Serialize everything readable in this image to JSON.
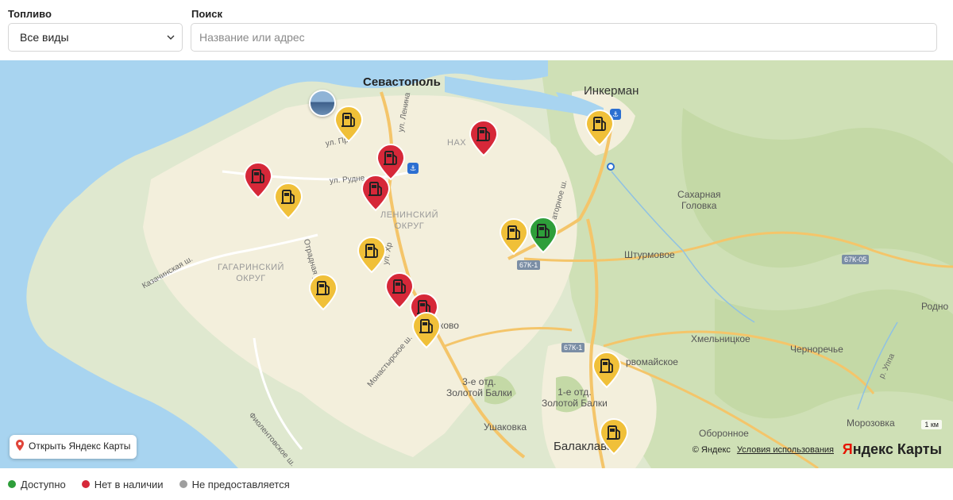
{
  "filters": {
    "fuel_label": "Топливо",
    "fuel_selected": "Все виды",
    "search_label": "Поиск",
    "search_placeholder": "Название или адрес"
  },
  "map": {
    "places": {
      "sevastopol": "Севастополь",
      "inkerman": "Инкерман",
      "sakharnaya_1": "Сахарная",
      "sakharnaya_2": "Головка",
      "shturmovoe": "Штурмовое",
      "khmelnitskoe": "Хмельницкое",
      "chernorechye": "Черноречье",
      "rodnoe": "Родно",
      "pervomayskoe": "рвомайское",
      "zolotaya_3_1": "3-е отд.",
      "zolotaya_3_2": "Золотой Балки",
      "zolotaya_1_1": "1-е отд.",
      "zolotaya_1_2": "Золотой Балки",
      "ushakovka": "Ушаковка",
      "balaklava": "Балаклава",
      "oboronnoe": "Оборонное",
      "morozovka": "Морозовка",
      "kamyshovo": "ково",
      "nakhimovsky": "НАХ",
      "leninsky_1": "ЛЕНИНСКИЙ",
      "leninsky_2": "ОКРУГ",
      "gagarinsky_1": "ГАГАРИНСКИЙ",
      "gagarinsky_2": "ОКРУГ"
    },
    "streets": {
      "lenina": "ул. Ленина",
      "pr": "ул. Пр",
      "rudneva": "ул. Рудне",
      "otradnaya": "Отрадная ул.",
      "kazachinskaya": "Казачинская ш.",
      "monastyrskoe": "Монастырское ш.",
      "fiolentovskoe": "Фиолентовское ш.",
      "khr": "ул. Хр",
      "sevastopol_sh": "аторное ш.",
      "r_uppa": "р. Уппа"
    },
    "road_badges": {
      "r1": "67К-1",
      "r2": "67К-1",
      "r3": "67К-05"
    },
    "open_button": "Открыть Яндекс Карты",
    "copyright": "© Яндекс",
    "terms": "Условия использования",
    "brand_y": "Я",
    "brand_rest": "ндекс Карты",
    "scale": "1 км",
    "stations": [
      {
        "status": "none"
      },
      {
        "status": "none"
      },
      {
        "status": "none"
      },
      {
        "status": "none"
      },
      {
        "status": "none"
      },
      {
        "status": "none"
      },
      {
        "status": "none"
      },
      {
        "status": "partial"
      },
      {
        "status": "partial"
      },
      {
        "status": "partial"
      },
      {
        "status": "partial"
      },
      {
        "status": "partial"
      },
      {
        "status": "partial"
      },
      {
        "status": "partial"
      },
      {
        "status": "partial"
      },
      {
        "status": "partial"
      },
      {
        "status": "available"
      }
    ]
  },
  "legend": {
    "available": "Доступно",
    "none": "Нет в наличии",
    "not_provided": "Не предоставляется"
  },
  "colors": {
    "available": "#2e9e3a",
    "none": "#d62839",
    "partial": "#f0c039",
    "not_provided": "#9e9e9e"
  }
}
